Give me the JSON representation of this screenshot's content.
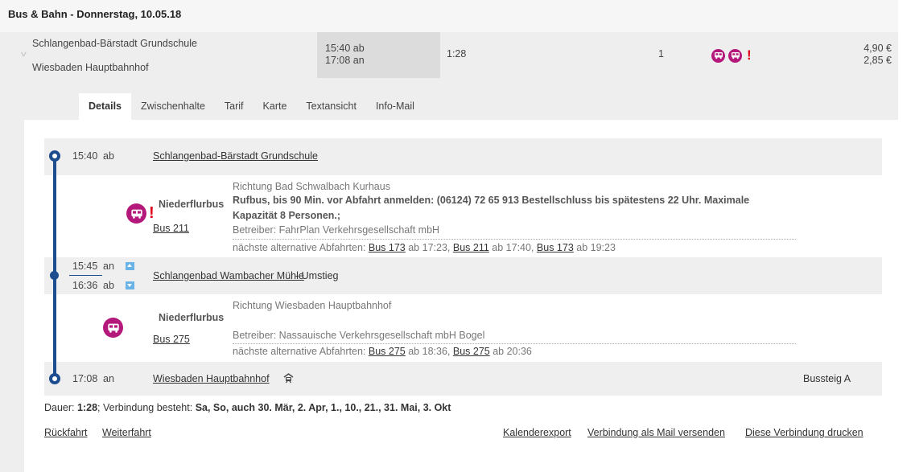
{
  "title": "Bus & Bahn - Donnerstag, 10.05.18",
  "summary": {
    "from": "Schlangenbad-Bärstadt Grundschule",
    "to": "Wiesbaden Hauptbahnhof",
    "dep": "15:40 ab",
    "arr": "17:08 an",
    "duration": "1:28",
    "changes": "1",
    "price_1": "4,90 €",
    "price_2": "2,85 €",
    "icons": [
      "bus-on-demand-icon",
      "bus-on-demand-icon",
      "warning-icon"
    ]
  },
  "tabs": [
    "Details",
    "Zwischenhalte",
    "Tarif",
    "Karte",
    "Textansicht",
    "Info-Mail"
  ],
  "stops": {
    "s1": {
      "time": "15:40",
      "mode": "ab",
      "name": "Schlangenbad-Bärstadt Grundschule"
    },
    "s2": {
      "time_arr": "15:45",
      "mode_arr": "an",
      "time_dep": "16:36",
      "mode_dep": "ab",
      "name": "Schlangenbad Wambacher Mühle",
      "suffix": "- Umstieg"
    },
    "s3": {
      "time": "17:08",
      "mode": "an",
      "name": "Wiesbaden Hauptbahnhof",
      "platform": "Bussteig A"
    }
  },
  "legs": {
    "l1": {
      "type": "Niederflurbus",
      "line": "Bus 211",
      "direction": "Richtung Bad Schwalbach Kurhaus",
      "notice_1": "Rufbus, bis 90 Min. vor Abfahrt anmelden: (06124) 72 65 913 Bestellschluss bis spätestens 22 Uhr. Maximale",
      "notice_2": "Kapazität 8 Personen.;",
      "operator": "Betreiber: FahrPlan Verkehrsgesellschaft mbH",
      "alt_label": "nächste alternative Abfahrten:",
      "alts": [
        {
          "line": "Bus 173",
          "time": "ab 17:23,"
        },
        {
          "line": "Bus 211",
          "time": "ab 17:40,"
        },
        {
          "line": "Bus 173",
          "time": "ab 19:23"
        }
      ]
    },
    "l2": {
      "type": "Niederflurbus",
      "line": "Bus 275",
      "direction": "Richtung Wiesbaden Hauptbahnhof",
      "operator": "Betreiber: Nassauische Verkehrsgesellschaft mbH Bogel",
      "alt_label": "nächste alternative Abfahrten:",
      "alts": [
        {
          "line": "Bus 275",
          "time": "ab 18:36,"
        },
        {
          "line": "Bus 275",
          "time": "ab 20:36"
        }
      ]
    }
  },
  "footer": {
    "duration_label": "Dauer:",
    "duration_value": "1:28",
    "validity_label": "; Verbindung besteht:",
    "validity_value": "Sa, So, auch 30. Mär, 2. Apr, 1., 10., 21., 31. Mai, 3. Okt",
    "links_left": [
      "Rückfahrt",
      "Weiterfahrt"
    ],
    "links_right": [
      "Kalenderexport",
      "Verbindung als Mail versenden",
      "Diese Verbindung drucken"
    ]
  },
  "colors": {
    "timeline": "#1e4d8f",
    "bus_icon": "#b3187a",
    "warning": "#e1001a",
    "arrow_button": "#6ab3e8"
  }
}
